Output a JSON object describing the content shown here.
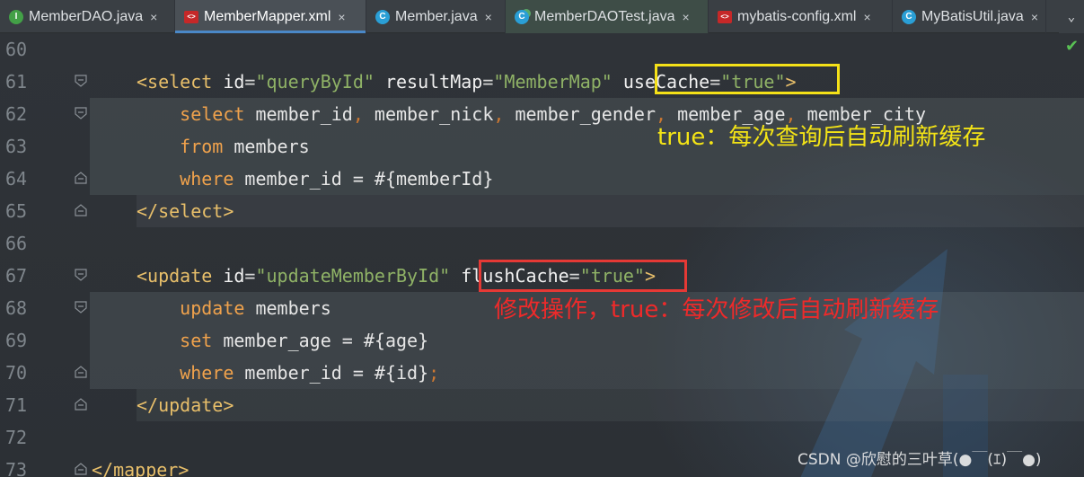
{
  "tabs": [
    {
      "label": "MemberDAO.java",
      "icon": "interface-icon",
      "icon_text": "I",
      "active": false
    },
    {
      "label": "MemberMapper.xml",
      "icon": "xml-file-icon",
      "icon_text": "<>",
      "active": true
    },
    {
      "label": "Member.java",
      "icon": "class-icon",
      "icon_text": "C",
      "active": false
    },
    {
      "label": "MemberDAOTest.java",
      "icon": "test-class-icon",
      "icon_text": "C",
      "active": false
    },
    {
      "label": "mybatis-config.xml",
      "icon": "xml-file-icon",
      "icon_text": "<>",
      "active": false
    },
    {
      "label": "MyBatisUtil.java",
      "icon": "class-icon",
      "icon_text": "C",
      "active": false
    }
  ],
  "tab_close_glyph": "×",
  "overflow_glyph": "⌄",
  "status_check": "✔",
  "lines": [
    {
      "num": "60",
      "segments": []
    },
    {
      "num": "61",
      "segments": [
        {
          "t": "<select ",
          "c": "tag"
        },
        {
          "t": "id",
          "c": "attr"
        },
        {
          "t": "=",
          "c": "eq"
        },
        {
          "t": "\"queryById\"",
          "c": "val"
        },
        {
          "t": " resultMap",
          "c": "attr"
        },
        {
          "t": "=",
          "c": "eq"
        },
        {
          "t": "\"MemberMap\"",
          "c": "val"
        },
        {
          "t": " useCache",
          "c": "attr"
        },
        {
          "t": "=",
          "c": "eq"
        },
        {
          "t": "\"true\"",
          "c": "val"
        },
        {
          "t": ">",
          "c": "tag"
        }
      ]
    },
    {
      "num": "62",
      "segments": [
        {
          "t": "    select",
          "c": "kw"
        },
        {
          "t": " member_id",
          "c": "plain"
        },
        {
          "t": ",",
          "c": "semi"
        },
        {
          "t": " member_nick",
          "c": "plain"
        },
        {
          "t": ",",
          "c": "semi"
        },
        {
          "t": " member_gender",
          "c": "plain"
        },
        {
          "t": ",",
          "c": "semi"
        },
        {
          "t": " member_age",
          "c": "plain"
        },
        {
          "t": ",",
          "c": "semi"
        },
        {
          "t": " member_city",
          "c": "plain"
        }
      ]
    },
    {
      "num": "63",
      "segments": [
        {
          "t": "    from",
          "c": "kw"
        },
        {
          "t": " members",
          "c": "plain"
        }
      ]
    },
    {
      "num": "64",
      "segments": [
        {
          "t": "    where",
          "c": "kw"
        },
        {
          "t": " member_id = #{memberId}",
          "c": "plain"
        }
      ]
    },
    {
      "num": "65",
      "segments": [
        {
          "t": "</select>",
          "c": "tag"
        }
      ]
    },
    {
      "num": "66",
      "segments": []
    },
    {
      "num": "67",
      "segments": [
        {
          "t": "<update ",
          "c": "tag"
        },
        {
          "t": "id",
          "c": "attr"
        },
        {
          "t": "=",
          "c": "eq"
        },
        {
          "t": "\"updateMemberById\"",
          "c": "val"
        },
        {
          "t": " flushCache",
          "c": "attr"
        },
        {
          "t": "=",
          "c": "eq"
        },
        {
          "t": "\"true\"",
          "c": "val"
        },
        {
          "t": ">",
          "c": "tag"
        }
      ]
    },
    {
      "num": "68",
      "segments": [
        {
          "t": "    update",
          "c": "kw"
        },
        {
          "t": " members",
          "c": "plain"
        }
      ]
    },
    {
      "num": "69",
      "segments": [
        {
          "t": "    set",
          "c": "kw"
        },
        {
          "t": " member_age = #{age}",
          "c": "plain"
        }
      ]
    },
    {
      "num": "70",
      "segments": [
        {
          "t": "    where",
          "c": "kw"
        },
        {
          "t": " member_id = #{id}",
          "c": "plain"
        },
        {
          "t": ";",
          "c": "semi"
        }
      ]
    },
    {
      "num": "71",
      "segments": [
        {
          "t": "</update>",
          "c": "tag"
        }
      ]
    },
    {
      "num": "72",
      "segments": []
    },
    {
      "num": "73",
      "segments": [
        {
          "t": "</mapper>",
          "c": "tag"
        }
      ]
    }
  ],
  "annotations": {
    "use_cache_note": "true：每次查询后自动刷新缓存",
    "flush_cache_note": "修改操作，true：每次修改后自动刷新缓存"
  },
  "watermark": "CSDN @欣慰的三叶草(●￣(ｴ)￣●)",
  "colors": {
    "highlight_yellow": "#f5e118",
    "highlight_red": "#e53935",
    "tab_underline": "#4a88c7"
  }
}
